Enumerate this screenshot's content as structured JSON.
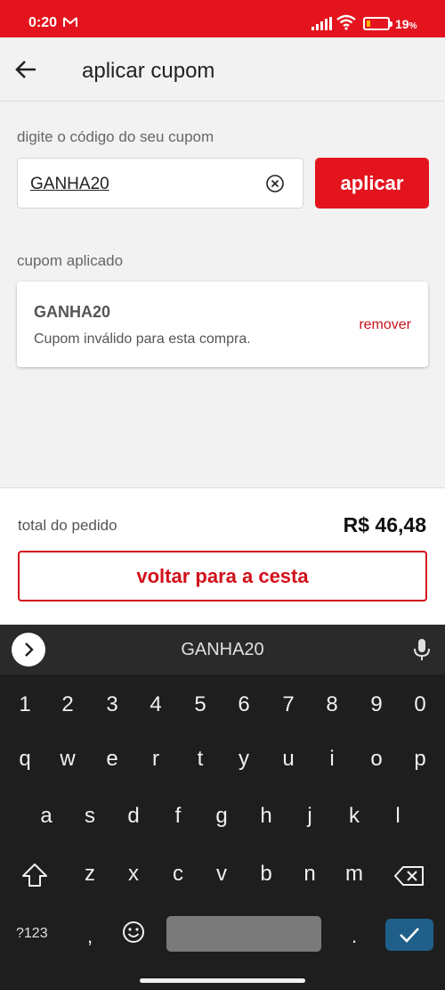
{
  "status_bar": {
    "time": "0:20",
    "battery_percent": "19",
    "battery_unit": "%"
  },
  "header": {
    "title": "aplicar cupom"
  },
  "coupon_entry": {
    "label": "digite o código do seu cupom",
    "value": "GANHA20",
    "apply_label": "aplicar"
  },
  "applied": {
    "label": "cupom aplicado",
    "code": "GANHA20",
    "message": "Cupom inválido para esta compra.",
    "remove_label": "remover"
  },
  "summary": {
    "total_label": "total do pedido",
    "total_value": "R$ 46,48",
    "back_button": "voltar para a cesta"
  },
  "keyboard": {
    "suggestion": "GANHA20",
    "row_numbers": [
      "1",
      "2",
      "3",
      "4",
      "5",
      "6",
      "7",
      "8",
      "9",
      "0"
    ],
    "row1": [
      "q",
      "w",
      "e",
      "r",
      "t",
      "y",
      "u",
      "i",
      "o",
      "p"
    ],
    "row2": [
      "a",
      "s",
      "d",
      "f",
      "g",
      "h",
      "j",
      "k",
      "l"
    ],
    "row3": [
      "z",
      "x",
      "c",
      "v",
      "b",
      "n",
      "m"
    ],
    "symbols_label": "?123",
    "comma": ",",
    "period": "."
  },
  "colors": {
    "brand_red": "#e3141e",
    "enter_blue": "#1f5f8a"
  },
  "icons": [
    "mail-icon",
    "signal-icon",
    "wifi-icon",
    "battery-icon",
    "back-arrow-icon",
    "clear-icon",
    "expand-icon",
    "mic-icon",
    "shift-icon",
    "backspace-icon",
    "emoji-icon",
    "check-icon"
  ]
}
